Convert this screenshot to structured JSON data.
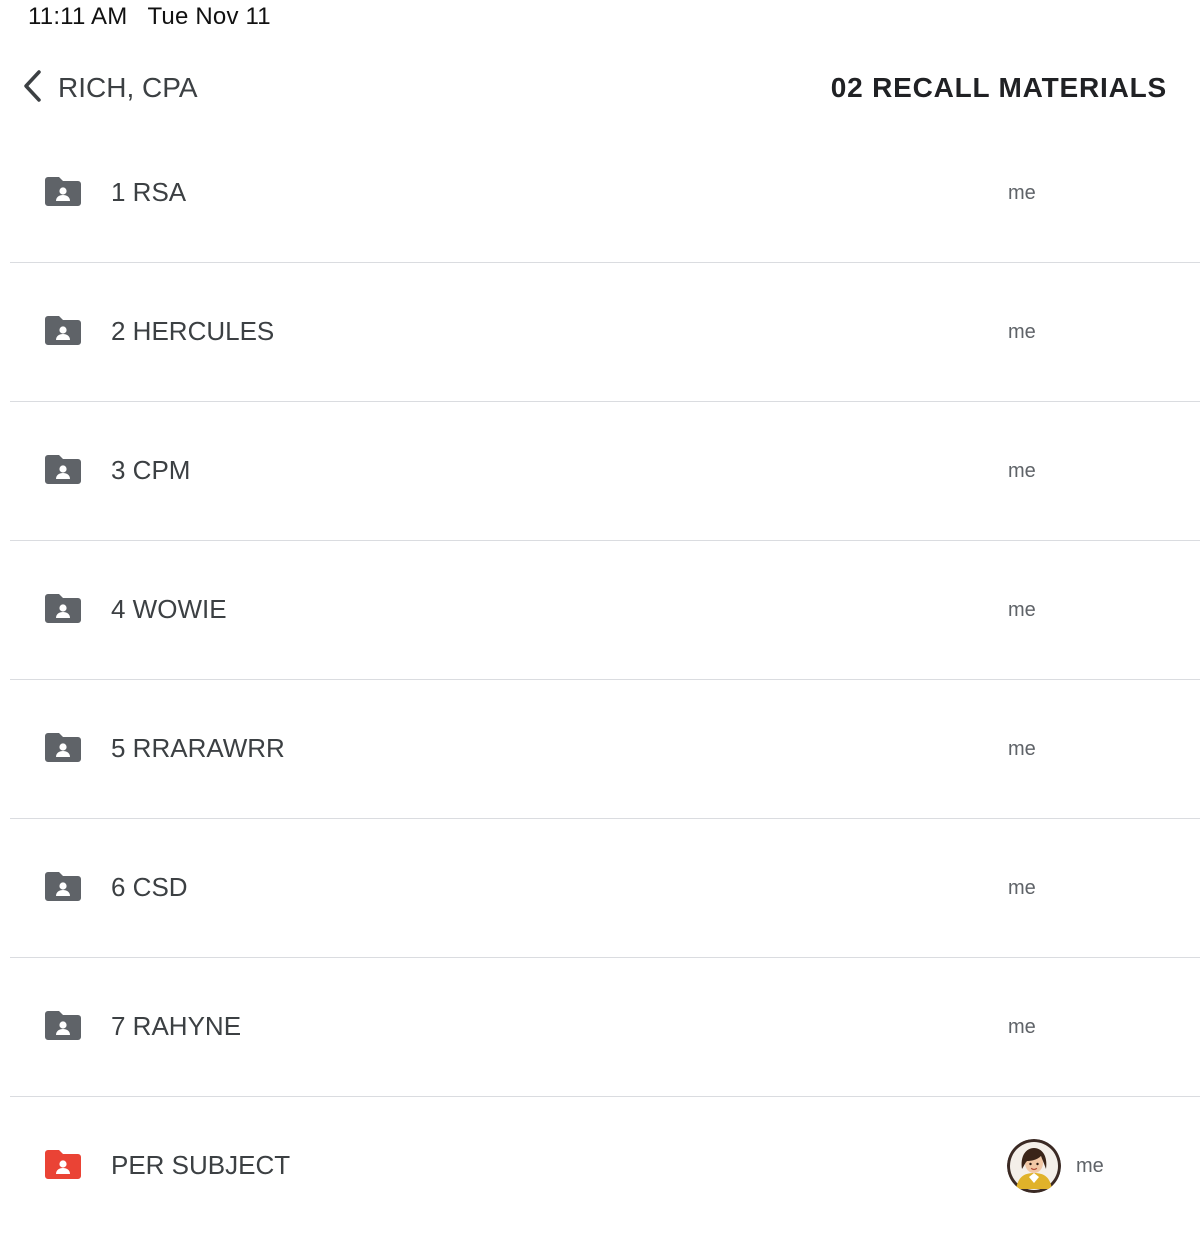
{
  "status_bar": {
    "time": "11:11 AM",
    "date": "Tue Nov 11"
  },
  "header": {
    "back_label": "RICH, CPA",
    "title": "02 RECALL MATERIALS"
  },
  "colors": {
    "folder_default": "#5f6368",
    "folder_accent": "#ea4335",
    "divider": "#dadce0",
    "text_primary": "#3c4043",
    "text_secondary": "#5f6368"
  },
  "files": [
    {
      "name": "1 RSA",
      "owner": "me",
      "folder_color": "#5f6368",
      "icon": "shared-folder-icon"
    },
    {
      "name": "2 HERCULES",
      "owner": "me",
      "folder_color": "#5f6368",
      "icon": "shared-folder-icon"
    },
    {
      "name": "3 CPM",
      "owner": "me",
      "folder_color": "#5f6368",
      "icon": "shared-folder-icon"
    },
    {
      "name": "4 WOWIE",
      "owner": "me",
      "folder_color": "#5f6368",
      "icon": "shared-folder-icon"
    },
    {
      "name": "5 RRARAWRR",
      "owner": "me",
      "folder_color": "#5f6368",
      "icon": "shared-folder-icon"
    },
    {
      "name": "6 CSD",
      "owner": "me",
      "folder_color": "#5f6368",
      "icon": "shared-folder-icon"
    },
    {
      "name": "7 RAHYNE",
      "owner": "me",
      "folder_color": "#5f6368",
      "icon": "shared-folder-icon"
    },
    {
      "name": "PER SUBJECT",
      "owner": "me",
      "folder_color": "#ea4335",
      "icon": "shared-folder-icon",
      "has_avatar": true
    }
  ]
}
